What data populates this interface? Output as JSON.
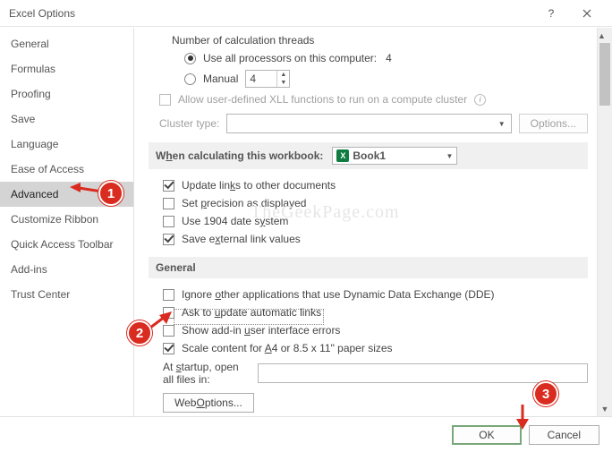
{
  "titlebar": {
    "title": "Excel Options"
  },
  "sidebar": {
    "items": [
      {
        "label": "General"
      },
      {
        "label": "Formulas"
      },
      {
        "label": "Proofing"
      },
      {
        "label": "Save"
      },
      {
        "label": "Language"
      },
      {
        "label": "Ease of Access"
      },
      {
        "label": "Advanced",
        "selected": true
      },
      {
        "label": "Customize Ribbon"
      },
      {
        "label": "Quick Access Toolbar"
      },
      {
        "label": "Add-ins"
      },
      {
        "label": "Trust Center"
      }
    ]
  },
  "calc": {
    "threads_label": "Number of calculation threads",
    "use_all_label": "Use all processors on this computer:",
    "use_all_count": "4",
    "manual_label": "Manual",
    "manual_value": "4",
    "allow_cluster_label": "Allow user-defined XLL functions to run on a compute cluster",
    "cluster_type_label": "Cluster type:",
    "options_btn": "Options..."
  },
  "workbook": {
    "heading": "When calculating this workbook:",
    "dropdown_value": "Book1",
    "update_links": "Update links to other documents",
    "set_precision": "Set precision as displayed",
    "use_1904": "Use 1904 date system",
    "save_external": "Save external link values"
  },
  "general": {
    "heading": "General",
    "ignore_dde": "Ignore other applications that use Dynamic Data Exchange (DDE)",
    "ask_update": "Ask to update automatic links",
    "show_addin_errors": "Show add-in user interface errors",
    "scale_a4": "Scale content for A4 or 8.5 x 11\" paper sizes",
    "startup_label": "At startup, open all files in:",
    "web_options_btn": "Web Options..."
  },
  "footer": {
    "ok": "OK",
    "cancel": "Cancel"
  },
  "annotations": {
    "b1": "1",
    "b2": "2",
    "b3": "3"
  },
  "watermark": "TheGeekPage.com"
}
